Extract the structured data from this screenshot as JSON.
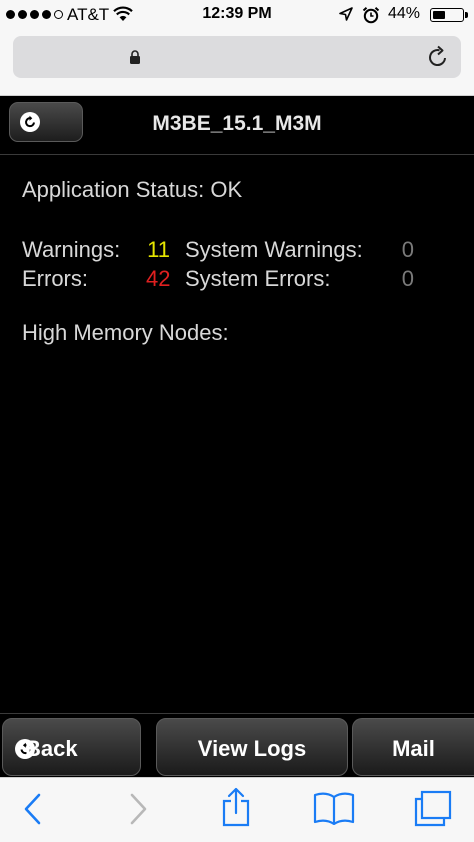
{
  "status_bar": {
    "carrier": "AT&T",
    "time": "12:39 PM",
    "battery_percent": "44%",
    "battery_level": 0.44,
    "icons": [
      "signal-dots-icon",
      "wifi-icon",
      "location-arrow-icon",
      "alarm-clock-icon",
      "battery-icon"
    ]
  },
  "url_bar": {
    "icons": [
      "lock-icon",
      "reload-icon"
    ]
  },
  "header": {
    "title": "M3BE_15.1_M3M",
    "refresh_icon": "refresh-icon"
  },
  "status": {
    "application_status_label": "Application Status:",
    "application_status_value": "OK",
    "warnings_label": "Warnings:",
    "warnings_value": "11",
    "system_warnings_label": "System Warnings:",
    "system_warnings_value": "0",
    "errors_label": "Errors:",
    "errors_value": "42",
    "system_errors_label": "System Errors:",
    "system_errors_value": "0",
    "high_memory_label": "High Memory Nodes:"
  },
  "footer": {
    "back_label": "Back",
    "view_logs_label": "View Logs",
    "mail_label": "Mail"
  },
  "safari_toolbar": {
    "icons": [
      "back-chevron-icon",
      "forward-chevron-icon",
      "share-icon",
      "bookmarks-icon",
      "tabs-icon"
    ]
  },
  "colors": {
    "warning": "#e6e600",
    "error": "#e02020",
    "ios_blue": "#1a7cf5"
  }
}
